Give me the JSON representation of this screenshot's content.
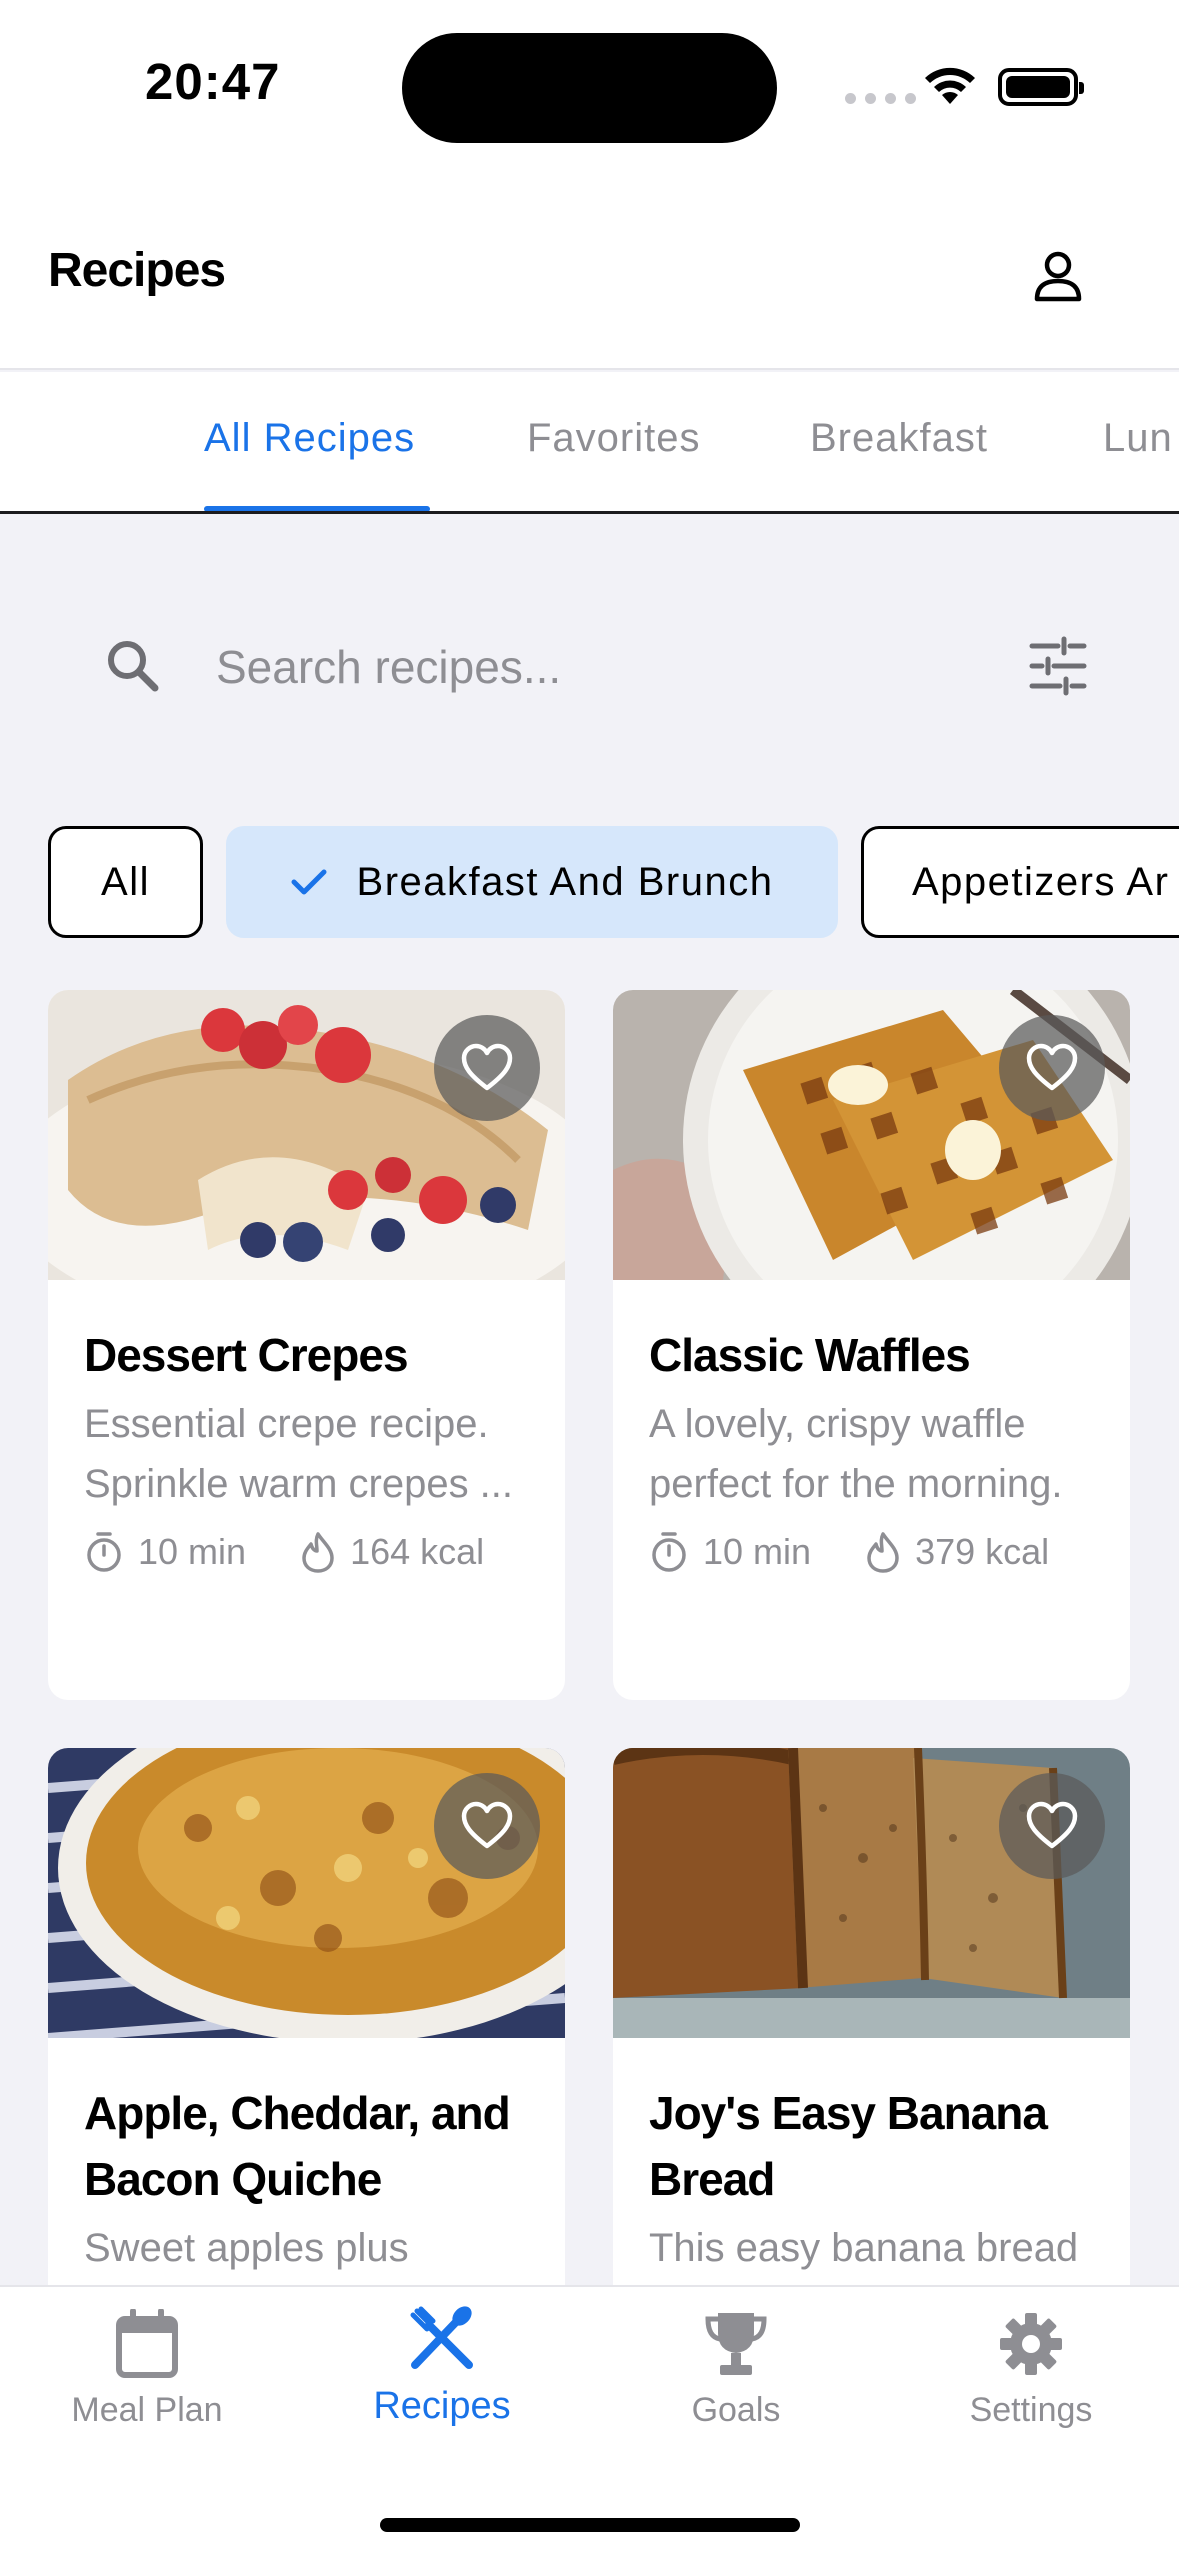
{
  "status": {
    "time": "20:47"
  },
  "header": {
    "title": "Recipes"
  },
  "tabs": [
    {
      "label": "All Recipes",
      "active": true
    },
    {
      "label": "Favorites",
      "active": false
    },
    {
      "label": "Breakfast",
      "active": false
    },
    {
      "label": "Lun",
      "active": false
    }
  ],
  "search": {
    "placeholder": "Search recipes..."
  },
  "chips": [
    {
      "label": "All",
      "selected": false
    },
    {
      "label": "Breakfast And Brunch",
      "selected": true
    },
    {
      "label": "Appetizers Ar",
      "selected": false
    }
  ],
  "recipes": [
    {
      "title": "Dessert Crepes",
      "description": "Essential crepe recipe. Sprinkle warm crepes ...",
      "time": "10 min",
      "calories": "164 kcal",
      "image": "crepes-photo"
    },
    {
      "title": "Classic Waffles",
      "description": "A lovely, crispy waffle perfect for the morning.",
      "time": "10 min",
      "calories": "379 kcal",
      "image": "waffles-photo"
    },
    {
      "title": "Apple, Cheddar, and Bacon Quiche",
      "description": "Sweet apples plus",
      "image": "quiche-photo"
    },
    {
      "title": "Joy's Easy Banana Bread",
      "description": "This easy banana bread",
      "image": "banana-bread-photo"
    }
  ],
  "tabbar": {
    "items": [
      {
        "label": "Meal Plan",
        "icon": "calendar-icon"
      },
      {
        "label": "Recipes",
        "icon": "utensils-icon",
        "active": true
      },
      {
        "label": "Goals",
        "icon": "trophy-icon"
      },
      {
        "label": "Settings",
        "icon": "gear-icon"
      }
    ]
  },
  "colors": {
    "accent": "#1a73e8",
    "chip_selected": "#d6e7fb",
    "background": "#f2f2f7",
    "muted": "#8e8e93"
  }
}
